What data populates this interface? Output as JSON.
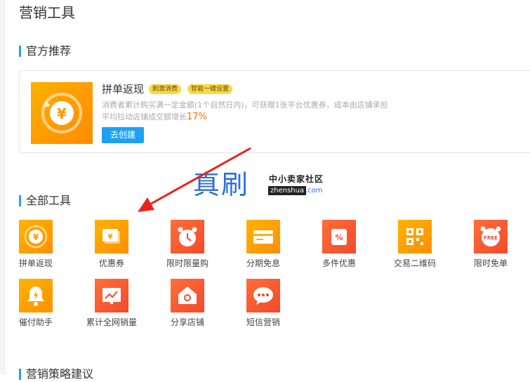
{
  "page": {
    "title": "营销工具"
  },
  "sections": {
    "recommended": "官方推荐",
    "all_tools": "全部工具",
    "strategy": "营销策略建议"
  },
  "feature": {
    "title": "拼单返现",
    "tags": [
      "刺激消费",
      "智能一键设置"
    ],
    "desc_line1": "消费者累计购买满一定金额(1个自然日内)，可获赠1张平台优惠券，成本由店铺承担",
    "desc_line2_prefix": "平均拉动店铺成交额增长",
    "desc_line2_value": "17%",
    "button": "去创建"
  },
  "tools": [
    {
      "label": "拼单返现",
      "icon": "refund-coin-icon"
    },
    {
      "label": "优惠券",
      "icon": "coupon-icon"
    },
    {
      "label": "限时限量购",
      "icon": "alarm-clock-icon"
    },
    {
      "label": "分期免息",
      "icon": "credit-card-icon"
    },
    {
      "label": "多件优惠",
      "icon": "discount-bag-icon"
    },
    {
      "label": "交易二维码",
      "icon": "qr-code-icon"
    },
    {
      "label": "限时免单",
      "icon": "free-clock-icon"
    },
    {
      "label": "催付助手",
      "icon": "bell-icon"
    },
    {
      "label": "累计全网销量",
      "icon": "sales-chart-icon"
    },
    {
      "label": "分享店铺",
      "icon": "share-shop-icon"
    },
    {
      "label": "短信营销",
      "icon": "sms-icon"
    }
  ],
  "watermark": {
    "big": "真刷",
    "cn": "中小卖家社区",
    "en": "zhenshua",
    "com": ".com"
  },
  "colors": {
    "accent": "#2a9fe8",
    "button": "#1ea1f2",
    "highlight": "#ff6a00",
    "annotation": "#e8231e"
  }
}
